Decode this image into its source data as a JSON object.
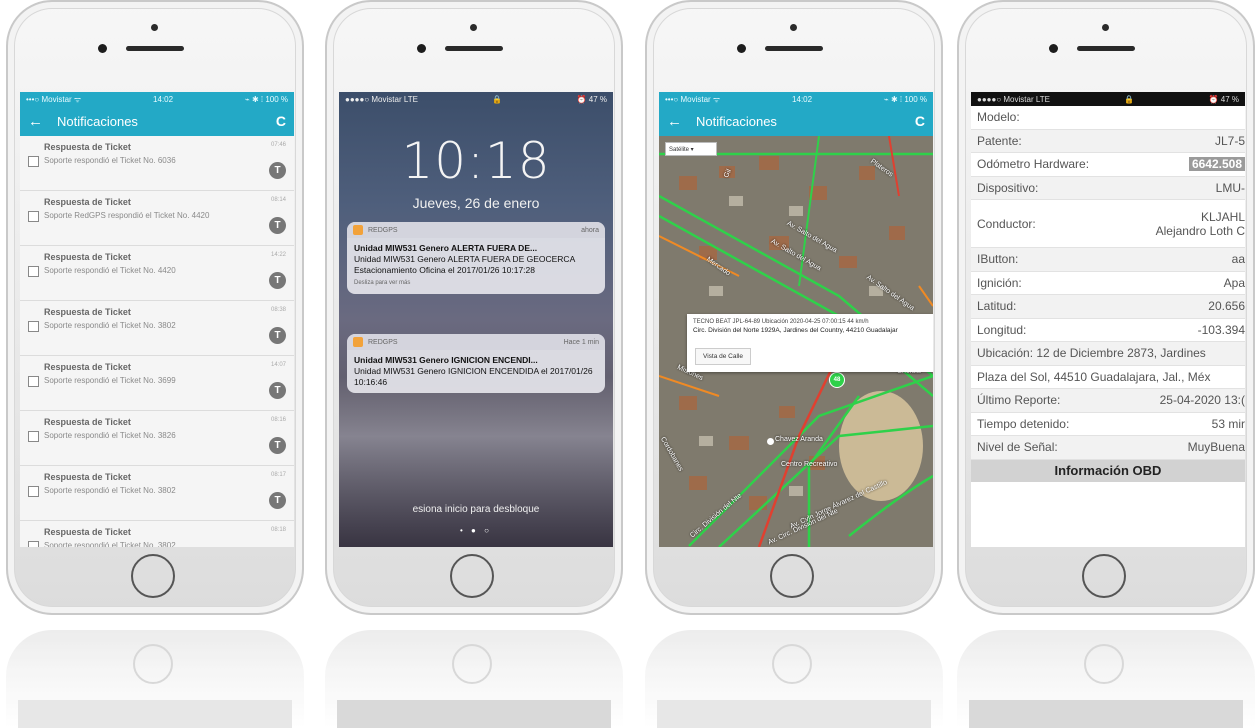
{
  "phone1": {
    "status": {
      "carrier": "•••○ Movistar ᯤ",
      "time": "14:02",
      "right": "⌁ ✱ ⁞ 100 %"
    },
    "appbar": {
      "title": "Notificaciones"
    },
    "items": [
      {
        "title": "Respuesta de Ticket",
        "desc": "Soporte respondió el Ticket No. 6036",
        "time": "07:46",
        "avatar": "T"
      },
      {
        "title": "Respuesta de Ticket",
        "desc": "Soporte RedGPS respondió el Ticket No. 4420",
        "time": "08:14",
        "avatar": "T"
      },
      {
        "title": "Respuesta de Ticket",
        "desc": "Soporte respondió el Ticket No. 4420",
        "time": "14:22",
        "avatar": "T"
      },
      {
        "title": "Respuesta de Ticket",
        "desc": "Soporte respondió el Ticket No. 3802",
        "time": "08:38",
        "avatar": "T"
      },
      {
        "title": "Respuesta de Ticket",
        "desc": "Soporte respondió el Ticket No. 3699",
        "time": "14:07",
        "avatar": "T"
      },
      {
        "title": "Respuesta de Ticket",
        "desc": "Soporte respondió el Ticket No. 3826",
        "time": "08:16",
        "avatar": "T"
      },
      {
        "title": "Respuesta de Ticket",
        "desc": "Soporte respondió el Ticket No. 3802",
        "time": "08:17",
        "avatar": "T"
      },
      {
        "title": "Respuesta de Ticket",
        "desc": "Soporte respondió el Ticket No. 3802",
        "time": "08:18",
        "avatar": "T"
      }
    ]
  },
  "phone2": {
    "status": {
      "carrier": "●●●●○ Movistar LTE",
      "lock": "🔒",
      "right": "⏰ 47 %"
    },
    "clock": "10:18",
    "date": "Jueves, 26 de enero",
    "notes": [
      {
        "app": "REDGPS",
        "age": "ahora",
        "title": "Unidad MIW531 Genero ALERTA FUERA DE...",
        "body": "Unidad MIW531 Genero ALERTA FUERA DE GEOCERCA Estacionamiento Oficina el 2017/01/26 10:17:28",
        "more": "Desliza para ver más"
      },
      {
        "app": "REDGPS",
        "age": "Hace 1 min",
        "title": "Unidad MIW531 Genero IGNICION ENCENDI...",
        "body": "Unidad MIW531 Genero IGNICION ENCENDIDA el 2017/01/26 10:16:46",
        "more": ""
      }
    ],
    "unlock": "esiona inicio para desbloque",
    "dots": "• ● ○"
  },
  "phone3": {
    "status": {
      "carrier": "•••○ Movistar ᯤ",
      "time": "14:02",
      "right": "⌁ ✱ ⁞ 100 %"
    },
    "appbar": {
      "title": "Notificaciones"
    },
    "map_type": "Satélite",
    "popup": {
      "line1": "TECNO BEAT JPL-64-89 Ubicación 2020-04-25 07:00:15 44 km/h",
      "line2": "Circ. División del Norte 1929A, Jardines del Country, 44210 Guadalajar",
      "button": "Vista de Calle"
    },
    "marker": "48",
    "labels": [
      "Plateros",
      "Av. Salto del Agua",
      "Av. Salto del Agua",
      "Av. Salto del Agua",
      "Mercado",
      "Misiones",
      "Cordobanes",
      "Circ. División del Nte",
      "Chavez Aranda",
      "Centro Recreativo",
      "Av. Cvln Jorge Álvarez del Castillo",
      "Av. Circ. División del Nte",
      "Cholula",
      "Gil",
      "Santa Ma"
    ],
    "colors": {
      "road_green": "#2fd14a",
      "road_red": "#e04030",
      "road_orange": "#f08a24"
    }
  },
  "phone4": {
    "status": {
      "carrier": "●●●●○ Movistar LTE",
      "lock": "🔒",
      "right": "⏰ 47 %"
    },
    "rows": [
      {
        "k": "Modelo:",
        "v": ""
      },
      {
        "k": "Patente:",
        "v": "JL7-5"
      },
      {
        "k": "Odómetro Hardware:",
        "v": "6642.508"
      },
      {
        "k": "Dispositivo:",
        "v": "LMU-"
      },
      {
        "k": "Conductor:",
        "v": "KLJAHL",
        "v2": "Alejandro Loth C"
      },
      {
        "k": "IButton:",
        "v": "aa"
      },
      {
        "k": "Ignición:",
        "v": "Apa"
      },
      {
        "k": "Latitud:",
        "v": "20.656"
      },
      {
        "k": "Longitud:",
        "v": "-103.394"
      }
    ],
    "ubicacion1": "Ubicación: 12 de Diciembre 2873, Jardines",
    "ubicacion2": "Plaza del Sol, 44510 Guadalajara, Jal., Méx",
    "rows2": [
      {
        "k": "Último Reporte:",
        "v": "25-04-2020 13:("
      },
      {
        "k": "Tiempo detenido:",
        "v": "53 mir"
      },
      {
        "k": "Nivel de Señal:",
        "v": "MuyBuena"
      }
    ],
    "obd": "Información OBD"
  }
}
